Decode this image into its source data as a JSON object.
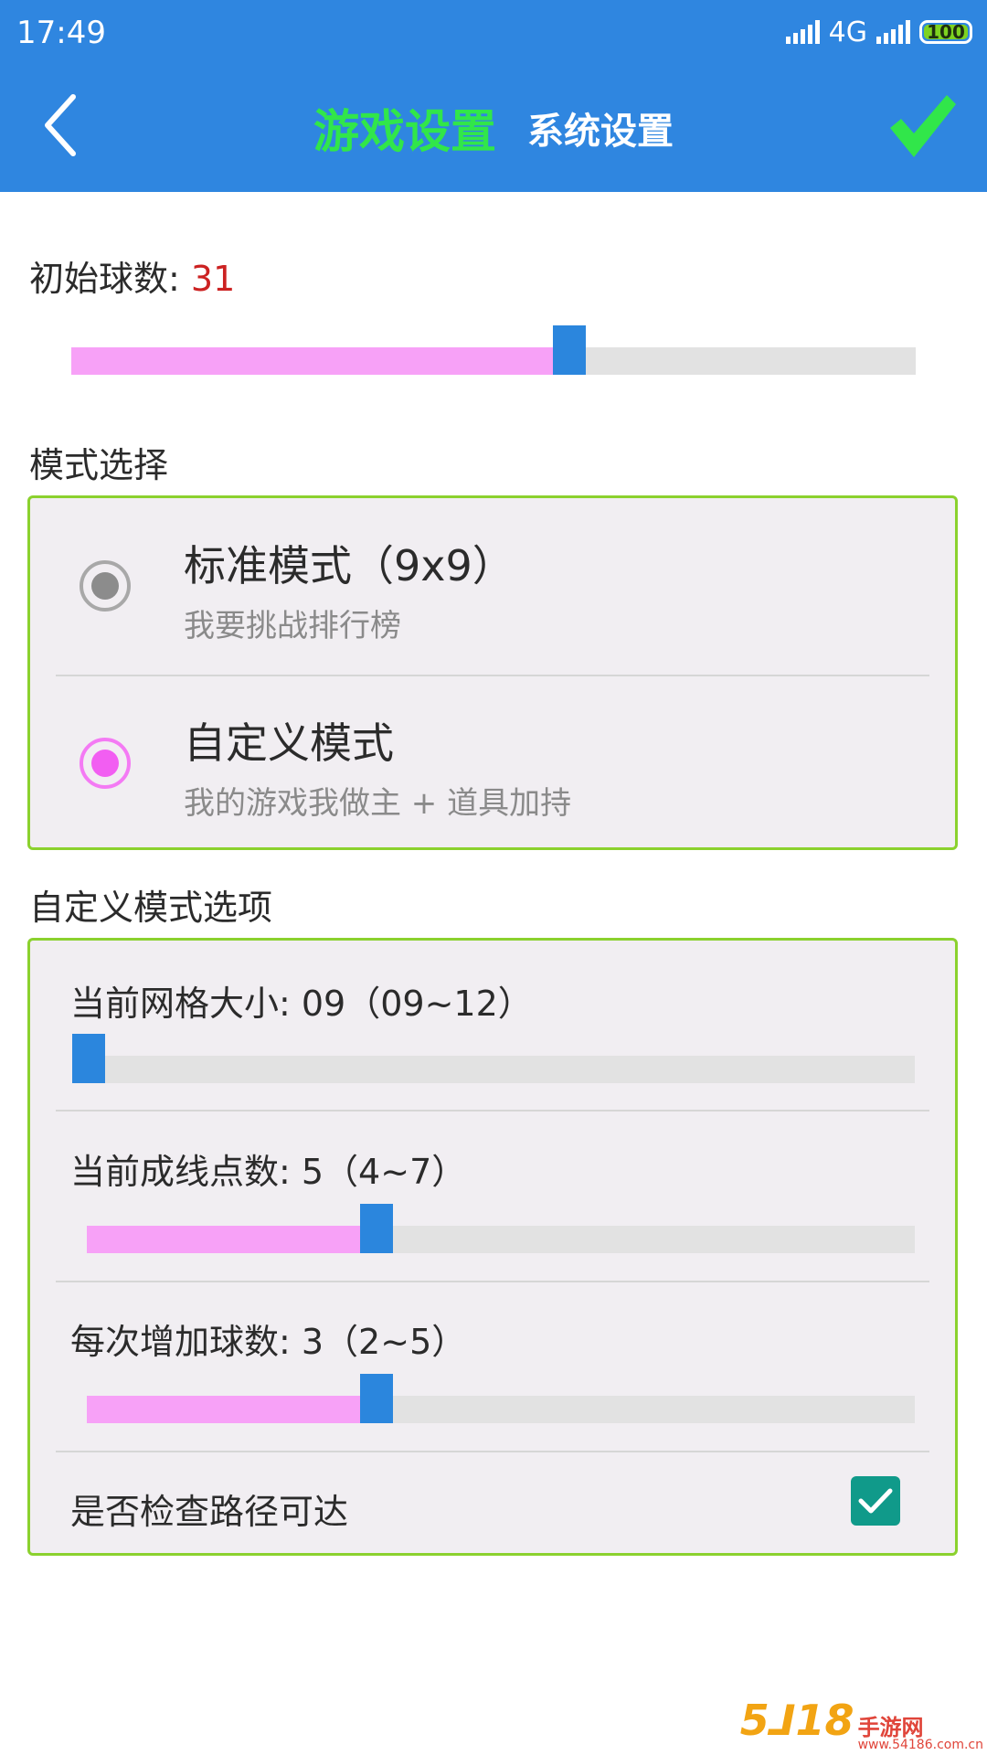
{
  "status_bar": {
    "time": "17:49",
    "network": "4G",
    "battery": "100"
  },
  "header": {
    "tab_game": "游戏设置",
    "tab_system": "系统设置"
  },
  "initial_balls": {
    "label": "初始球数:",
    "value": "31",
    "slider_fraction": 0.57
  },
  "mode_select": {
    "heading": "模式选择",
    "options": [
      {
        "title": "标准模式（9x9）",
        "subtitle": "我要挑战排行榜",
        "selected": false
      },
      {
        "title": "自定义模式",
        "subtitle": "我的游戏我做主 + 道具加持",
        "selected": true
      }
    ]
  },
  "custom_options": {
    "heading": "自定义模式选项",
    "grid_size": {
      "label": "当前网格大小: 09（09~12）",
      "slider_fraction": 0.0
    },
    "line_points": {
      "label": "当前成线点数: 5（4~7）",
      "slider_fraction": 0.33
    },
    "balls_per_turn": {
      "label": "每次增加球数: 3（2~5）",
      "slider_fraction": 0.33
    },
    "check_path": {
      "label": "是否检查路径可达",
      "checked": true
    }
  },
  "colors": {
    "header_bg": "#2f86e0",
    "active_tab": "#31e64a",
    "slider_fill": "#f7a1f7",
    "slider_thumb": "#2b86dd",
    "panel_border": "#8bd12e",
    "value_red": "#cc2222",
    "checkbox": "#109a8a"
  },
  "watermark": {
    "logo": "5ᒧ18",
    "name": "手游网",
    "url": "www.54186.com.cn"
  }
}
